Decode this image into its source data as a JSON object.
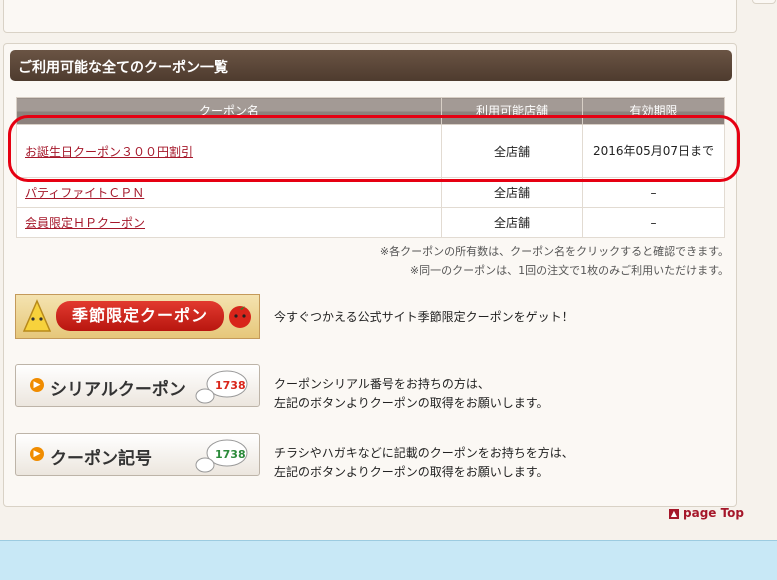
{
  "section": {
    "title": "ご利用可能な全てのクーポン一覧"
  },
  "table": {
    "headers": [
      "クーポン名",
      "利用可能店舗",
      "有効期限"
    ],
    "rows": [
      {
        "name": "お誕生日クーポン３００円割引",
        "stores": "全店舗",
        "expiry": "2016年05月07日まで"
      },
      {
        "name": "パティファイトＣＰＮ",
        "stores": "全店舗",
        "expiry": "–"
      },
      {
        "name": "会員限定ＨＰクーポン",
        "stores": "全店舗",
        "expiry": "–"
      }
    ]
  },
  "notes": [
    "※各クーポンの所有数は、クーポン名をクリックすると確認できます。",
    "※同一のクーポンは、1回の注文で1枚のみご利用いただけます。"
  ],
  "promos": [
    {
      "label": "季節限定クーポン",
      "desc": "今すぐつかえる公式サイト季節限定クーポンをゲット！"
    },
    {
      "label": "シリアルクーポン",
      "desc_line1": "クーポンシリアル番号をお持ちの方は、",
      "desc_line2": "左記のボタンよりクーポンの取得をお願いします。",
      "bubble": "1738"
    },
    {
      "label": "クーポン記号",
      "desc_line1": "チラシやハガキなどに記載のクーポンをお持ちを方は、",
      "desc_line2": "左記のボタンよりクーポンの取得をお願いします。",
      "bubble": "1738"
    }
  ],
  "page_top": "page Top",
  "colors": {
    "header_brown": "#5a4536",
    "link_red": "#a5172a",
    "highlight_red": "#e60012"
  }
}
